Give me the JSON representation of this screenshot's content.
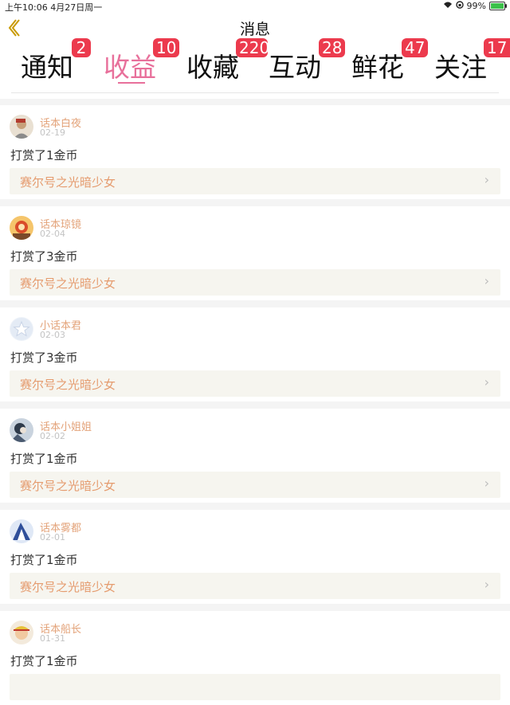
{
  "status": {
    "time_date": "上午10:06   4月27日周一",
    "battery": "99%",
    "battery_level": 0.99
  },
  "header": {
    "title": "消息",
    "back_icon": "chevron-left-icon"
  },
  "tabs": [
    {
      "label": "通知",
      "badge": "2"
    },
    {
      "label": "收益",
      "badge": "10"
    },
    {
      "label": "收藏",
      "badge": "220"
    },
    {
      "label": "互动",
      "badge": "28"
    },
    {
      "label": "鲜花",
      "badge": "47"
    },
    {
      "label": "关注",
      "badge": "17"
    }
  ],
  "active_tab": "收益",
  "colors": {
    "accent": "#e8709b",
    "badge": "#ec3a4d",
    "username": "#e3a37a",
    "work_title": "#e59c6f",
    "back": "#d8a200"
  },
  "items": [
    {
      "user": "话本白夜",
      "date": "02-19",
      "action": "打赏了1金币",
      "work": "赛尔号之光暗少女"
    },
    {
      "user": "话本琼镜",
      "date": "02-04",
      "action": "打赏了3金币",
      "work": "赛尔号之光暗少女"
    },
    {
      "user": "小话本君",
      "date": "02-03",
      "action": "打赏了3金币",
      "work": "赛尔号之光暗少女"
    },
    {
      "user": "话本小姐姐",
      "date": "02-02",
      "action": "打赏了1金币",
      "work": "赛尔号之光暗少女"
    },
    {
      "user": "话本雾都",
      "date": "02-01",
      "action": "打赏了1金币",
      "work": "赛尔号之光暗少女"
    },
    {
      "user": "话本船长",
      "date": "01-31",
      "action": "打赏了1金币",
      "work": ""
    }
  ]
}
